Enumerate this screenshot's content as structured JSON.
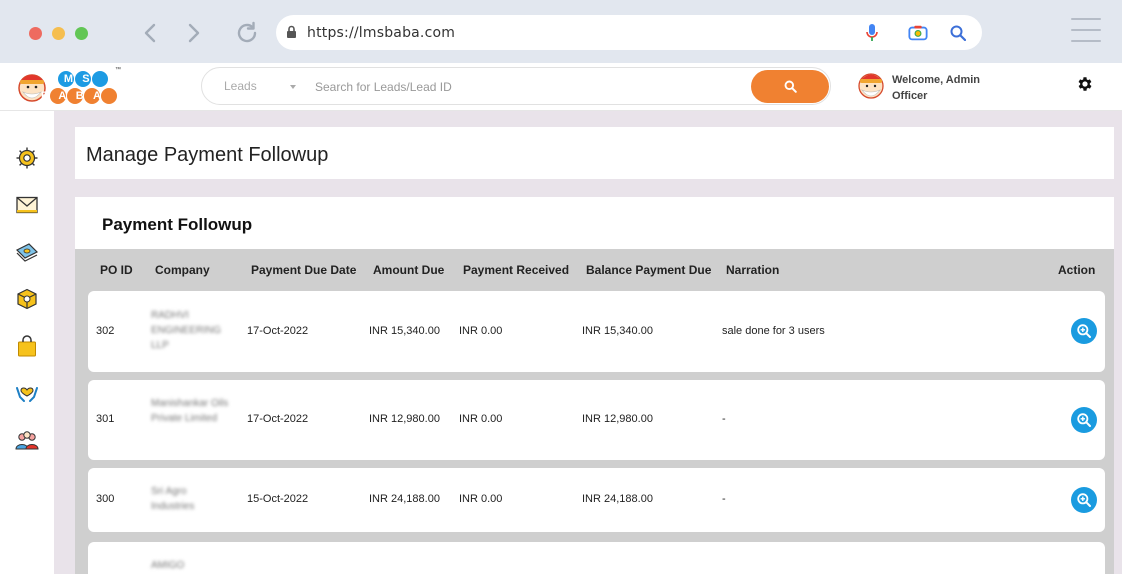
{
  "browser": {
    "url": "https://lmsbaba.com"
  },
  "header": {
    "logo_letters_top": "LMS",
    "logo_letters_bottom": "BABA",
    "logo_tm": "™",
    "search": {
      "category": "Leads",
      "placeholder": "Search for Leads/Lead ID"
    },
    "welcome_line1": "Welcome, Admin",
    "welcome_line2": "Officer"
  },
  "sidebar": {
    "items": [
      "settings-sun-icon",
      "mail-icon",
      "money-icon",
      "box-icon",
      "shopping-bag-icon",
      "care-hands-icon",
      "team-icon"
    ]
  },
  "page": {
    "title": "Manage Payment Followup",
    "section_title": "Payment Followup"
  },
  "table": {
    "columns": [
      "PO ID",
      "Company",
      "Payment Due Date",
      "Amount Due",
      "Payment Received",
      "Balance Payment Due",
      "Narration",
      "Action"
    ],
    "rows": [
      {
        "po_id": "302",
        "company": "RADHVI ENGINEERING LLP",
        "due_date": "17-Oct-2022",
        "amount_due": "INR 15,340.00",
        "received": "INR 0.00",
        "balance": "INR 15,340.00",
        "narration": "sale done for 3 users"
      },
      {
        "po_id": "301",
        "company": "Manishankar Oils Private Limited",
        "due_date": "17-Oct-2022",
        "amount_due": "INR 12,980.00",
        "received": "INR 0.00",
        "balance": "INR 12,980.00",
        "narration": "-"
      },
      {
        "po_id": "300",
        "company": "Sri Agro Industries",
        "due_date": "15-Oct-2022",
        "amount_due": "INR 24,188.00",
        "received": "INR 0.00",
        "balance": "INR 24,188.00",
        "narration": "-"
      },
      {
        "po_id": "",
        "company": "AMIGO",
        "due_date": "",
        "amount_due": "",
        "received": "",
        "balance": "",
        "narration": ""
      }
    ]
  },
  "colors": {
    "accent_orange": "#f08131",
    "action_blue": "#1a9be0",
    "table_header_bg": "#cfcfcf"
  }
}
